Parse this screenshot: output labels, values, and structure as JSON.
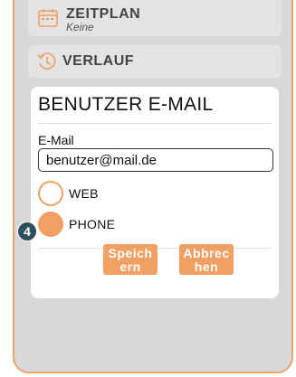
{
  "menu": {
    "zeitplan": {
      "title": "ZEITPLAN",
      "subtitle": "Keine",
      "icon": "calendar-icon"
    },
    "verlauf": {
      "title": "VERLAUF",
      "icon": "history-clock-icon"
    }
  },
  "dialog": {
    "title": "BENUTZER E-MAIL",
    "email_label": "E-Mail",
    "email_value": "benutzer@mail.de",
    "options": [
      {
        "label": "WEB",
        "selected": false
      },
      {
        "label": "PHONE",
        "selected": true
      }
    ],
    "save_label": "Speich\nern",
    "cancel_label": "Abbrec\nhen"
  },
  "annotation": {
    "step": "4"
  },
  "colors": {
    "accent": "#f0a063",
    "frame": "#e8a46a",
    "badge": "#2f4f5e",
    "background": "#d8d8d8"
  }
}
